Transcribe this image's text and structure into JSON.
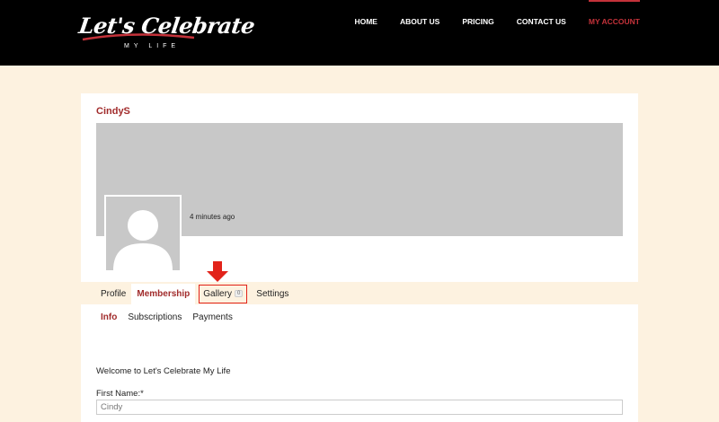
{
  "brand": {
    "logo_text": "Let's Celebrate",
    "logo_subtext": "MY LIFE"
  },
  "nav": {
    "items": [
      {
        "label": "HOME"
      },
      {
        "label": "ABOUT US"
      },
      {
        "label": "PRICING"
      },
      {
        "label": "CONTACT US"
      },
      {
        "label": "MY ACCOUNT",
        "active": true
      }
    ]
  },
  "profile": {
    "username": "CindyS",
    "timestamp": "4 minutes ago"
  },
  "tabs": [
    {
      "label": "Profile"
    },
    {
      "label": "Membership",
      "active": true
    },
    {
      "label": "Gallery",
      "count": "0",
      "highlighted": true
    },
    {
      "label": "Settings"
    }
  ],
  "subtabs": [
    {
      "label": "Info",
      "active": true
    },
    {
      "label": "Subscriptions"
    },
    {
      "label": "Payments"
    }
  ],
  "form": {
    "welcome": "Welcome to Let's Celebrate My Life",
    "first_name_label": "First Name:*",
    "first_name_value": "Cindy"
  },
  "colors": {
    "accent": "#a12b2b",
    "nav_active": "#c4323a",
    "highlight": "#e2231a",
    "page_bg": "#fdf2e0"
  },
  "icons": {
    "avatar": "user-silhouette-icon",
    "pointer": "red-down-arrow-icon"
  }
}
